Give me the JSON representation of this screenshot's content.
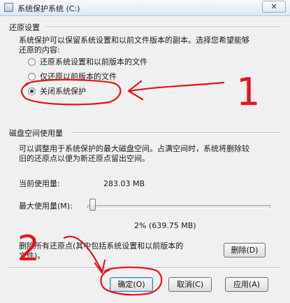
{
  "window": {
    "title": "系统保护系统 (C:)",
    "close_label": "✕"
  },
  "restore_settings": {
    "group_title": "还原设置",
    "description_line1": "系统保护可以保留系统设置和以前文件版本的副本。选择您希望能够",
    "description_line2": "还原的内容:",
    "options": [
      {
        "label": "还原系统设置和以前版本的文件",
        "checked": false
      },
      {
        "label": "仅还原以前版本的文件",
        "checked": false
      },
      {
        "label": "关闭系统保护",
        "checked": true
      }
    ]
  },
  "disk_usage": {
    "group_title": "磁盘空间使用量",
    "description_line1": "可以调整用于系统保护的最大磁盘空间。占满空间时，系统将删除较",
    "description_line2": "旧的还原点以便为新还原点留出空间。",
    "current_label": "当前使用量:",
    "current_value": "283.03 MB",
    "max_label": "最大使用量(M):",
    "max_value": "2% (639.75 MB)",
    "slider_fraction": 0.02
  },
  "delete_section": {
    "text_line1": "删除所有还原点(其中包括系统设置和以前版本的",
    "text_line2": "文件)。",
    "delete_button": "删除(D)"
  },
  "footer": {
    "ok": "确定(O)",
    "cancel": "取消(C)",
    "apply": "应用(A)"
  },
  "annotations": {
    "number_1": "1",
    "number_2": "2",
    "stroke_color": "#e8141c"
  }
}
